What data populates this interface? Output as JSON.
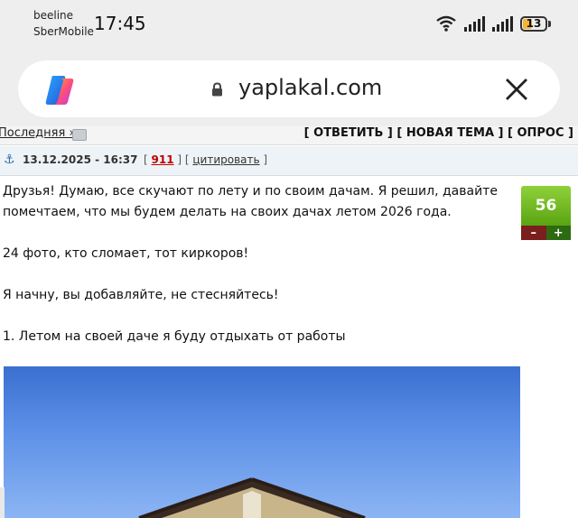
{
  "status_bar": {
    "carrier_1": "beeline",
    "carrier_2": "SberMobile",
    "time": "17:45",
    "battery": "13",
    "icons": [
      "wifi-icon",
      "signal-icon",
      "signal-icon",
      "battery-icon"
    ]
  },
  "browser": {
    "url": "yaplakal.com",
    "app_icon": "copilot-icon",
    "lock_icon": "lock-icon",
    "close_icon": "close-icon"
  },
  "forum_nav": {
    "last_link": "Последняя »",
    "actions": "[ ОТВЕТИТЬ ] [ НОВАЯ ТЕМА ] [ ОПРОС ]"
  },
  "post": {
    "date": "13.12.2025 - 16:37",
    "number": "911",
    "quote_label": "цитировать",
    "rating": "56",
    "rating_minus": "–",
    "rating_plus": "+",
    "paragraphs": [
      "Друзья! Думаю, все скучают по лету и по своим дачам. Я решил, давайте помечтаем, что мы будем делать на своих дачах летом 2026 года.",
      "24 фото, кто сломает, тот киркоров!",
      "Я начну, вы добавляйте, не стесняйтесь!",
      "1. Летом на своей даче я буду отдыхать от работы"
    ]
  },
  "colors": {
    "rating_green": "#6bbf1f",
    "number_red": "#c00000",
    "sky_blue": "#4a7fdc"
  }
}
